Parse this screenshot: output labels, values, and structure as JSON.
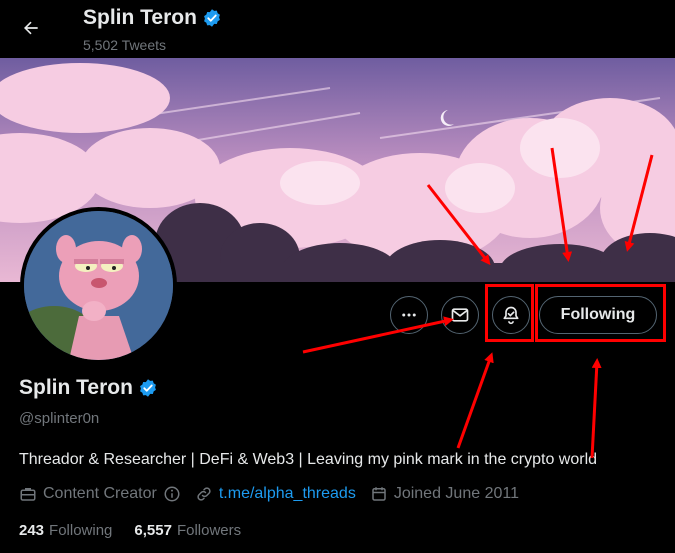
{
  "header": {
    "display_name": "Splin Teron",
    "tweet_count": "5,502 Tweets"
  },
  "profile": {
    "display_name": "Splin Teron",
    "handle": "@splinter0n",
    "bio": "Threador & Researcher | DeFi & Web3 | Leaving my pink mark in the crypto world",
    "category": "Content Creator",
    "link": "t.me/alpha_threads",
    "joined": "Joined June 2011"
  },
  "actions": {
    "follow_label": "Following"
  },
  "stats": {
    "following_count": "243",
    "following_label": "Following",
    "followers_count": "6,557",
    "followers_label": "Followers"
  },
  "colors": {
    "background": "#000000",
    "text": "#e7e9ea",
    "muted": "#71767b",
    "accent": "#1d9bf0",
    "annotation": "#ff0000"
  }
}
